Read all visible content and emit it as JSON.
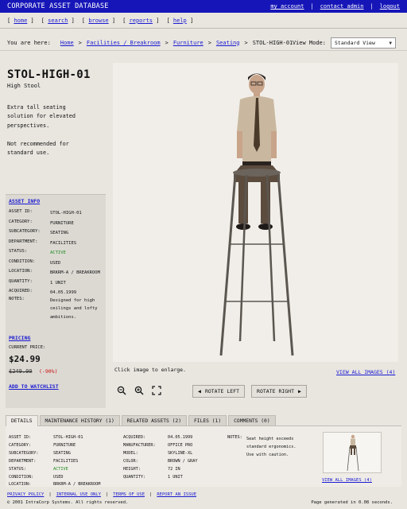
{
  "header": {
    "title": "CORPORATE ASSET DATABASE",
    "links": [
      "my_account",
      "contact_admin",
      "logout"
    ]
  },
  "nav": {
    "items": [
      "home",
      "search",
      "browse",
      "reports",
      "help"
    ]
  },
  "breadcrumb": {
    "label": "You are here:",
    "items": [
      "Home",
      "Facilities / Breakroom",
      "Furniture",
      "Seating"
    ],
    "current": "STOL-HIGH-01"
  },
  "view_mode": {
    "label": "View Mode:",
    "value": "Standard View"
  },
  "asset": {
    "code": "STOL-HIGH-01",
    "name": "High Stool",
    "description": "Extra tall seating solution for elevated perspectives.",
    "note": "Not recommended for standard use."
  },
  "asset_info": {
    "heading": "ASSET INFO",
    "rows": [
      {
        "k": "ASSET ID:",
        "v": "STOL-HIGH-01"
      },
      {
        "k": "CATEGORY:",
        "v": "FURNITURE"
      },
      {
        "k": "SUBCATEGORY:",
        "v": "SEATING"
      },
      {
        "k": "DEPARTMENT:",
        "v": "FACILITIES"
      },
      {
        "k": "STATUS:",
        "v": "ACTIVE"
      },
      {
        "k": "CONDITION:",
        "v": "USED"
      },
      {
        "k": "LOCATION:",
        "v": "BRKRM-A / BREAKROOM"
      },
      {
        "k": "QUANTITY:",
        "v": "1 UNIT"
      },
      {
        "k": "ACQUIRED:",
        "v": "04.05.1999"
      },
      {
        "k": "NOTES:",
        "v": "Designed for high ceilings and lofty ambitions."
      }
    ]
  },
  "pricing": {
    "heading": "PRICING",
    "current_label": "CURRENT PRICE:",
    "price": "$24.99",
    "old_price": "$249.00",
    "discount": "(-90%)",
    "watchlist": "ADD TO WATCHLIST"
  },
  "image": {
    "caption": "Click image to enlarge.",
    "view_all": "VIEW ALL IMAGES (4)",
    "rotate_left": "ROTATE LEFT",
    "rotate_right": "ROTATE RIGHT"
  },
  "tabs": [
    "DETAILS",
    "MAINTENANCE HISTORY (1)",
    "RELATED ASSETS (2)",
    "FILES (1)",
    "COMMENTS (0)"
  ],
  "details": {
    "col1": [
      {
        "k": "ASSET ID:",
        "v": "STOL-HIGH-01"
      },
      {
        "k": "CATEGORY:",
        "v": "FURNITURE"
      },
      {
        "k": "SUBCATEGORY:",
        "v": "SEATING"
      },
      {
        "k": "DEPARTMENT:",
        "v": "FACILITIES"
      },
      {
        "k": "STATUS:",
        "v": "ACTIVE"
      },
      {
        "k": "CONDITION:",
        "v": "USED"
      },
      {
        "k": "LOCATION:",
        "v": "BRKRM-A / BREAKROOM"
      }
    ],
    "col2": [
      {
        "k": "ACQUIRED:",
        "v": "04.05.1999"
      },
      {
        "k": "MANUFACTURER:",
        "v": "OFFICE PRO"
      },
      {
        "k": "MODEL:",
        "v": "SKYLINE-XL"
      },
      {
        "k": "COLOR:",
        "v": "BROWN / GRAY"
      },
      {
        "k": "HEIGHT:",
        "v": "72 IN"
      },
      {
        "k": "QUANTITY:",
        "v": "1 UNIT"
      }
    ],
    "notes_label": "NOTES:",
    "notes": "Seat height exceeds standard ergonomics. Use with caution.",
    "thumb_link": "VIEW ALL IMAGES (4)"
  },
  "footer": {
    "links": [
      "PRIVACY POLICY",
      "INTERNAL USE ONLY",
      "TERMS OF USE",
      "REPORT AN ISSUE"
    ],
    "copyright": "© 2001 IntraCorp Systems. All rights reserved.",
    "generated": "Page generated in 0.08 seconds."
  },
  "colors": {
    "header_bg": "#1616b8",
    "link": "#1a1ad0",
    "active": "#1f8b1f",
    "discount": "#cc1111"
  }
}
